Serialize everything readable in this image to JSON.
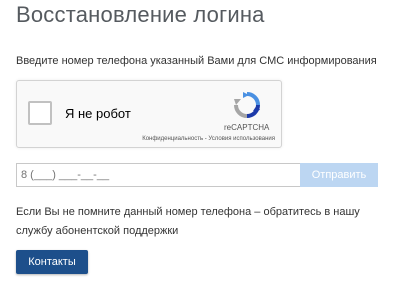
{
  "page": {
    "title": "Восстановление логина",
    "instruction": "Введите номер телефона указанный Вами для СМС информирования"
  },
  "captcha": {
    "checkbox_label": "Я не робот",
    "brand": "reCAPTCHA",
    "links": "Конфиденциальность - Условия использования",
    "checked": false
  },
  "form": {
    "phone_placeholder": "8 (___) ___-__-__",
    "send_label": "Отправить"
  },
  "help": {
    "text": "Если Вы не помните данный номер телефона – обратитесь в нашу службу абонентской поддержки",
    "contacts_label": "Контакты"
  },
  "colors": {
    "accent": "#1d4f8b",
    "send_disabled": "#bcd6f2",
    "title": "#555a5f"
  }
}
